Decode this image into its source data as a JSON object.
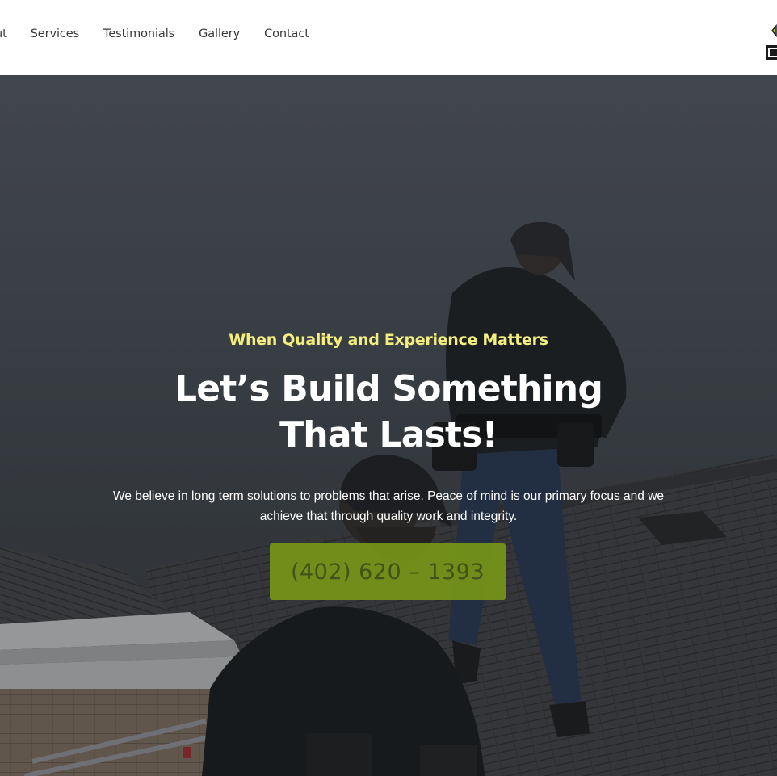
{
  "nav": {
    "items": [
      {
        "label": "ut"
      },
      {
        "label": "Services"
      },
      {
        "label": "Testimonials"
      },
      {
        "label": "Gallery"
      },
      {
        "label": "Contact"
      }
    ]
  },
  "hero": {
    "kicker": "When Quality and Experience Matters",
    "headline": "Let’s Build Something That Lasts!",
    "subtext": "We believe in long term solutions to problems that arise. Peace of mind is our primary focus and we achieve that through quality work and integrity.",
    "cta_label": "(402) 620 – 1393"
  },
  "colors": {
    "accent": "#f3ee7e",
    "cta_bg": "#769618",
    "logo_yellow": "#c8d42a"
  },
  "icons": {
    "logo": "company-logo"
  }
}
